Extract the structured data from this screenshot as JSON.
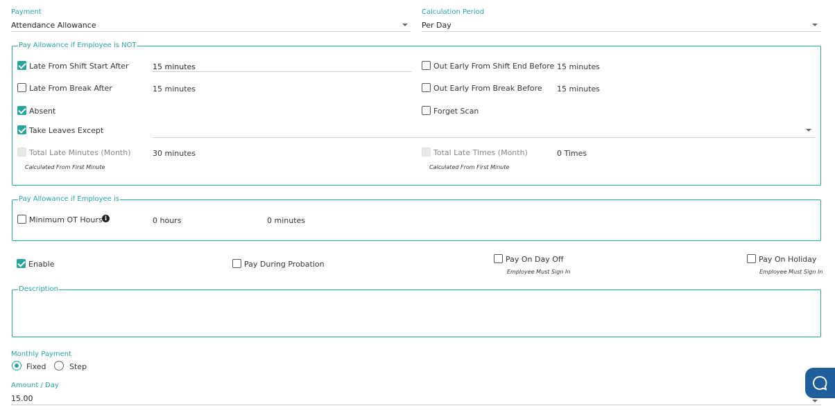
{
  "payment": {
    "label": "Payment",
    "value": "Attendance Allowance"
  },
  "calculation_period": {
    "label": "Calculation Period",
    "value": "Per Day"
  },
  "not_section": {
    "legend": "Pay Allowance if Employee is NOT",
    "late_shift_start": {
      "label": "Late From Shift Start After",
      "value": "15 minutes",
      "checked": true
    },
    "out_early_shift_end": {
      "label": "Out Early From Shift End Before",
      "value": "15 minutes",
      "checked": false
    },
    "late_break": {
      "label": "Late From Break After",
      "value": "15 minutes",
      "checked": false
    },
    "out_early_break": {
      "label": "Out Early From Break Before",
      "value": "15 minutes",
      "checked": false
    },
    "absent": {
      "label": "Absent",
      "checked": true
    },
    "forget_scan": {
      "label": "Forget Scan",
      "checked": false
    },
    "take_leaves": {
      "label": "Take Leaves Except",
      "checked": true
    },
    "total_late_minutes": {
      "label": "Total Late Minutes (Month)",
      "value": "30 minutes",
      "note": "Calculated From First Minute"
    },
    "total_late_times": {
      "label": "Total Late Times (Month)",
      "value": "0 Times",
      "note": "Calculated From First Minute"
    }
  },
  "is_section": {
    "legend": "Pay Allowance if Employee is",
    "min_ot": {
      "label": "Minimum OT Hours",
      "hours": "0 hours",
      "minutes": "0 minutes",
      "checked": false
    }
  },
  "options": {
    "enable": {
      "label": "Enable",
      "checked": true
    },
    "probation": {
      "label": "Pay During Probation",
      "checked": false
    },
    "day_off": {
      "label": "Pay On Day Off",
      "note": "Employee Must Sign In",
      "checked": false
    },
    "holiday": {
      "label": "Pay On Holiday",
      "note": "Employee Must Sign In",
      "checked": false
    }
  },
  "description": {
    "legend": "Description",
    "value": ""
  },
  "monthly_payment": {
    "label": "Monthly Payment",
    "fixed": "Fixed",
    "step": "Step",
    "selected": "Fixed"
  },
  "amount": {
    "label": "Amount / Day",
    "value": "15.00"
  },
  "icons": {
    "info": "info-icon",
    "help": "chat-help-icon",
    "caret": "chevron-down-icon"
  },
  "colors": {
    "accent": "#26a69a",
    "help_button": "#1f5e9c"
  }
}
